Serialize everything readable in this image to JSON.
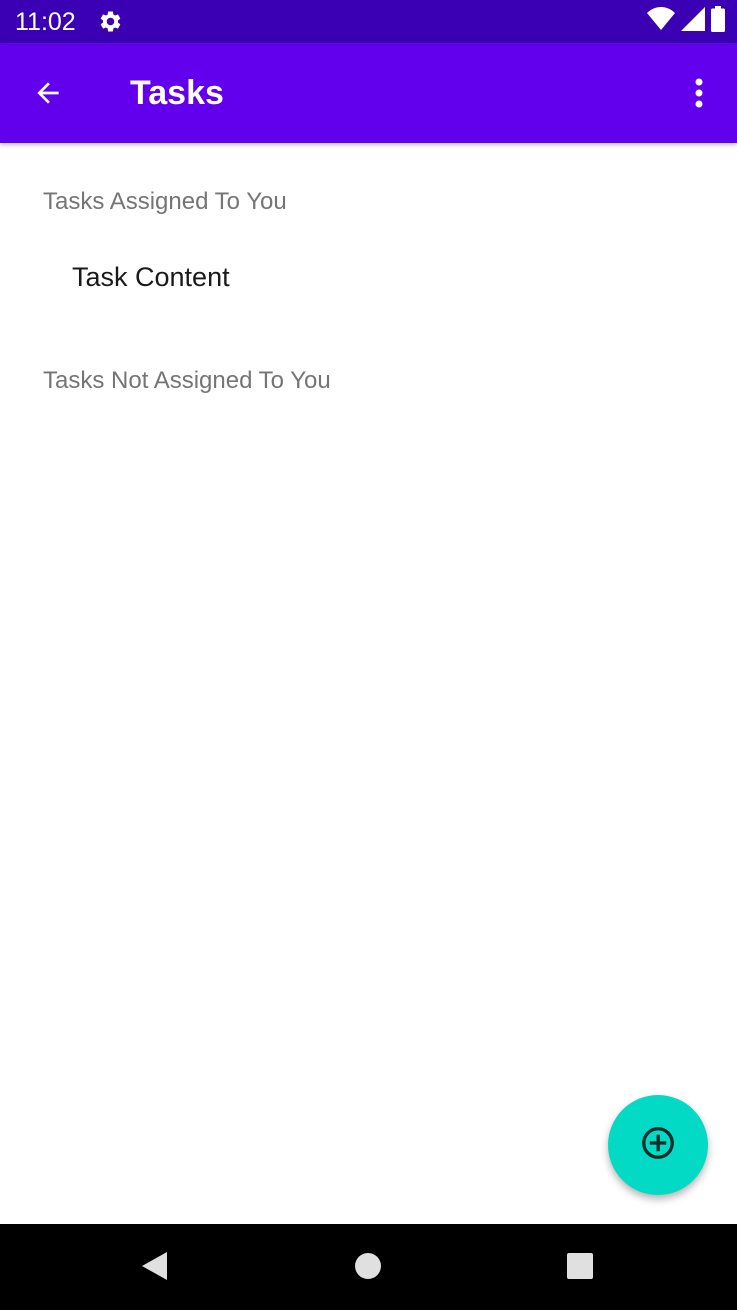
{
  "status_bar": {
    "time": "11:02",
    "icons": [
      "settings-icon",
      "wifi-icon",
      "cell-signal-icon",
      "battery-icon"
    ]
  },
  "app_bar": {
    "title": "Tasks",
    "back_icon": "arrow-back-icon",
    "menu_icon": "more-vert-icon"
  },
  "sections": {
    "assigned": {
      "header": "Tasks Assigned To You",
      "items": [
        {
          "label": "Task Content"
        }
      ]
    },
    "not_assigned": {
      "header": "Tasks Not Assigned To You",
      "items": []
    }
  },
  "fab": {
    "icon": "add-circle-icon"
  },
  "colors": {
    "status_bar": "#3b00b3",
    "app_bar": "#6200ee",
    "fab": "#03dac5",
    "section_header": "#757575",
    "nav_bar": "#000000"
  }
}
